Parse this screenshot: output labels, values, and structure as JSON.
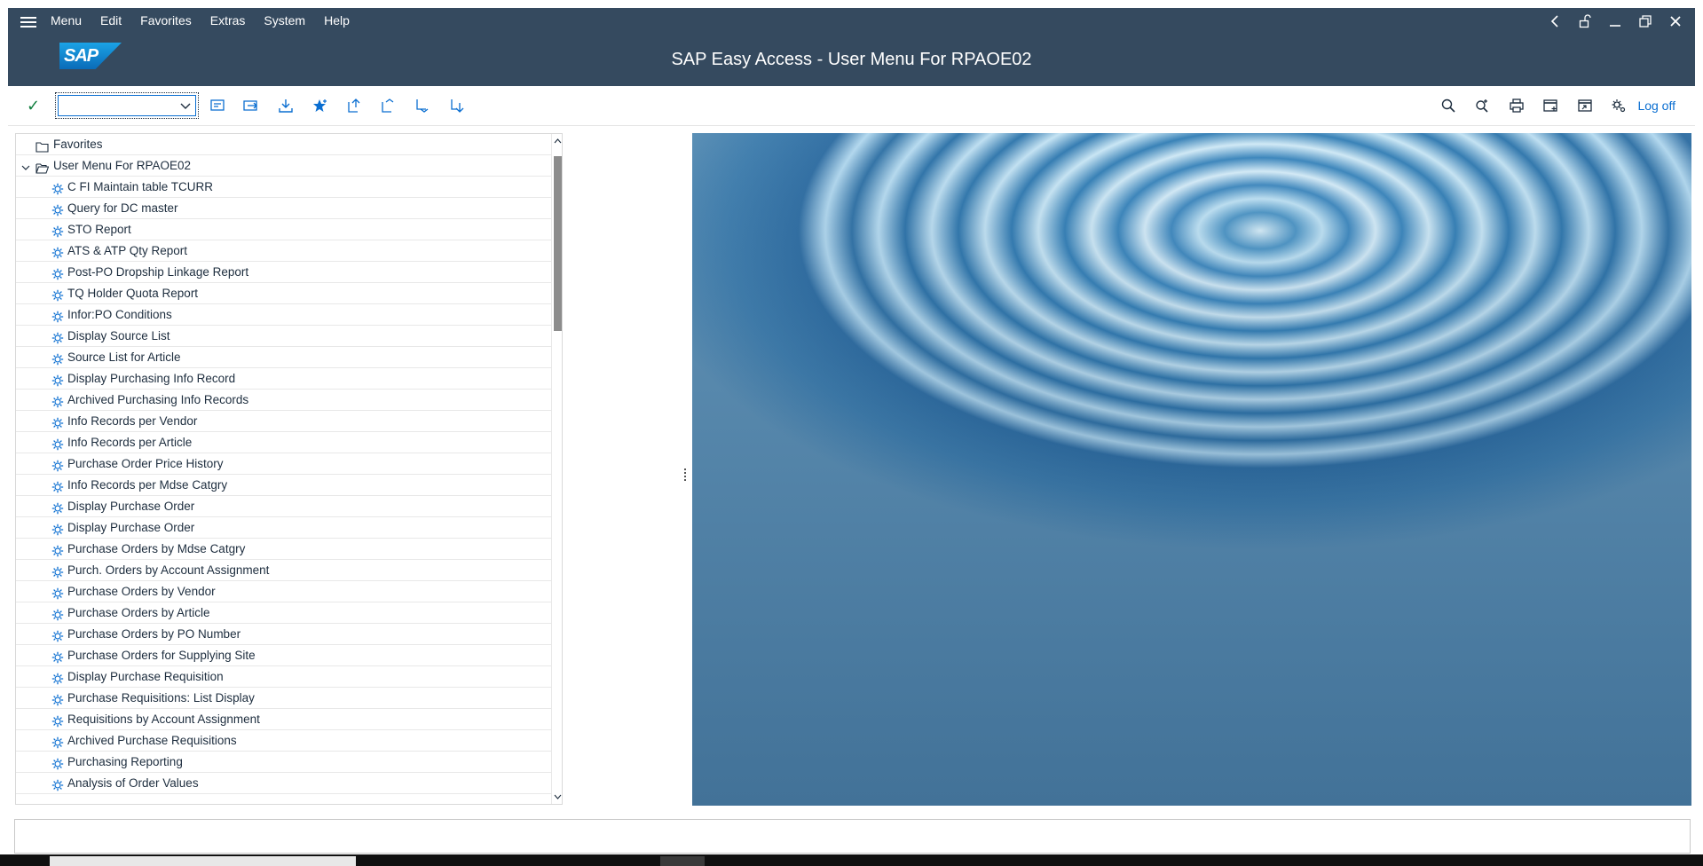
{
  "menubar": {
    "items": [
      {
        "label": "Menu"
      },
      {
        "label": "Edit"
      },
      {
        "label": "Favorites"
      },
      {
        "label": "Extras"
      },
      {
        "label": "System"
      },
      {
        "label": "Help"
      }
    ]
  },
  "title": {
    "logo_text": "SAP",
    "text": "SAP Easy Access  -  User Menu For RPAOE02"
  },
  "toolbar": {
    "command_field_value": "",
    "logoff_label": "Log off"
  },
  "tree": {
    "favorites_label": "Favorites",
    "root_label": "User Menu For RPAOE02",
    "items": [
      {
        "label": "C FI Maintain table TCURR"
      },
      {
        "label": "Query for DC master"
      },
      {
        "label": "STO Report"
      },
      {
        "label": "ATS & ATP Qty Report"
      },
      {
        "label": "Post-PO Dropship Linkage Report"
      },
      {
        "label": "TQ Holder Quota Report"
      },
      {
        "label": "Infor:PO Conditions"
      },
      {
        "label": "Display Source List"
      },
      {
        "label": "Source List for Article"
      },
      {
        "label": "Display Purchasing Info Record"
      },
      {
        "label": "Archived Purchasing Info Records"
      },
      {
        "label": "Info Records per Vendor"
      },
      {
        "label": "Info Records per Article"
      },
      {
        "label": "Purchase Order Price History"
      },
      {
        "label": "Info Records per Mdse Catgry"
      },
      {
        "label": "Display Purchase Order"
      },
      {
        "label": "Display Purchase Order"
      },
      {
        "label": "Purchase Orders by Mdse Catgry"
      },
      {
        "label": "Purch. Orders by Account Assignment"
      },
      {
        "label": "Purchase Orders by Vendor"
      },
      {
        "label": "Purchase Orders by Article"
      },
      {
        "label": "Purchase Orders by PO Number"
      },
      {
        "label": "Purchase Orders for Supplying Site"
      },
      {
        "label": "Display Purchase Requisition"
      },
      {
        "label": "Purchase Requisitions: List Display"
      },
      {
        "label": "Requisitions by Account Assignment"
      },
      {
        "label": "Archived Purchase Requisitions"
      },
      {
        "label": "Purchasing Reporting"
      },
      {
        "label": "Analysis of Order Values"
      }
    ]
  },
  "colors": {
    "shell_header": "#354a5f",
    "accent_blue": "#0a6ed1",
    "enter_green": "#107e3e"
  },
  "icons": {
    "menu": "hamburger-icon",
    "tree_item": "transaction-gear-icon",
    "folder": "folder-icon"
  }
}
